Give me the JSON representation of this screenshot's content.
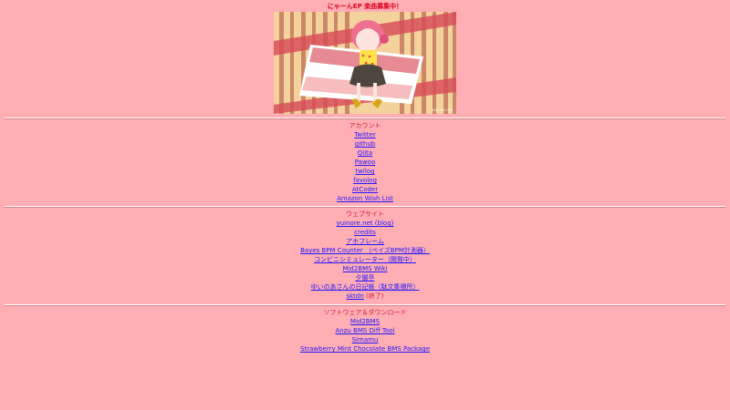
{
  "banner": "にゃーんEP 楽曲募集中！",
  "hero": {
    "watermark": "vuinore.net",
    "colors": {
      "background": "#f3d29b",
      "stripe": "#be6f58",
      "red": "#d84c59",
      "white": "#ffffff"
    }
  },
  "accounts": {
    "title": "アカウント",
    "items": [
      {
        "label": "Twitter"
      },
      {
        "label": "github"
      },
      {
        "label": "Qiita"
      },
      {
        "label": "Pawoo"
      },
      {
        "label": "twilog"
      },
      {
        "label": "favolog"
      },
      {
        "label": "AtCoder"
      },
      {
        "label": "Amazon Wish List"
      }
    ]
  },
  "websites": {
    "title": "ウェブサイト",
    "items": [
      {
        "label": "yuinore.net (blog)"
      },
      {
        "label": "credits"
      },
      {
        "label": "アホフレーム"
      },
      {
        "label": "Bayes BPM Counter （ベイズBPM計測器）"
      },
      {
        "label": "コンビニシミュレーター（開発中）"
      },
      {
        "label": "Mid2BMS Wiki"
      },
      {
        "label": "夕闇亭"
      },
      {
        "label": "ゆいのあさんの日記帳（駄文集積所）"
      },
      {
        "label": "sktdn",
        "note": "(終了)"
      }
    ]
  },
  "software": {
    "title": "ソフトウェア＆ダウンロード",
    "items": [
      {
        "label": "Mid2BMS"
      },
      {
        "label": "Anzu BMS Diff Tool"
      },
      {
        "label": "Simamu"
      },
      {
        "label": "Strawberry Mint Chocolate BMS Package"
      }
    ]
  },
  "colors": {
    "page_background": "#ffaeb4",
    "text": "#d11d3a",
    "link": "#2316ff",
    "divider_light": "#ffffff",
    "divider_dark": "#cd8489"
  }
}
